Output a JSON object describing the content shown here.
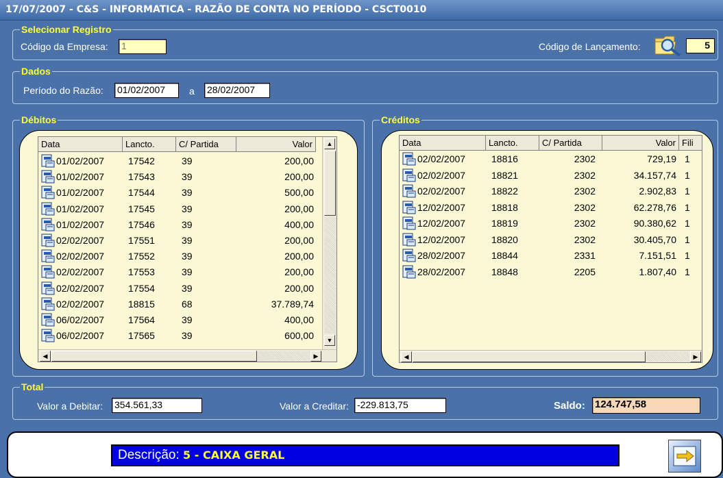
{
  "window": {
    "title": "17/07/2007 - C&S - INFORMATICA - RAZÃO DE CONTA NO PERÍODO - CSCT0010"
  },
  "selecionar": {
    "legend": "Selecionar Registro",
    "empresa_label": "Código da Empresa:",
    "empresa_value": "1",
    "lancamento_label": "Código de Lançamento:",
    "lancamento_value": "5"
  },
  "dados": {
    "legend": "Dados",
    "periodo_label": "Período do Razão:",
    "data_inicio": "01/02/2007",
    "separator": "a",
    "data_fim": "28/02/2007"
  },
  "debitos": {
    "legend": "Débitos",
    "columns": [
      "Data",
      "Lancto.",
      "C/ Partida",
      "Valor"
    ],
    "rows": [
      [
        "01/02/2007",
        "17542",
        "39",
        "200,00"
      ],
      [
        "01/02/2007",
        "17543",
        "39",
        "200,00"
      ],
      [
        "01/02/2007",
        "17544",
        "39",
        "500,00"
      ],
      [
        "01/02/2007",
        "17545",
        "39",
        "200,00"
      ],
      [
        "01/02/2007",
        "17546",
        "39",
        "400,00"
      ],
      [
        "02/02/2007",
        "17551",
        "39",
        "200,00"
      ],
      [
        "02/02/2007",
        "17552",
        "39",
        "200,00"
      ],
      [
        "02/02/2007",
        "17553",
        "39",
        "200,00"
      ],
      [
        "02/02/2007",
        "17554",
        "39",
        "200,00"
      ],
      [
        "02/02/2007",
        "18815",
        "68",
        "37.789,74"
      ],
      [
        "06/02/2007",
        "17564",
        "39",
        "400,00"
      ],
      [
        "06/02/2007",
        "17565",
        "39",
        "600,00"
      ]
    ]
  },
  "creditos": {
    "legend": "Créditos",
    "columns": [
      "Data",
      "Lancto.",
      "C/ Partida",
      "Valor",
      "Fili"
    ],
    "rows": [
      [
        "02/02/2007",
        "18816",
        "2302",
        "729,19",
        "1"
      ],
      [
        "02/02/2007",
        "18821",
        "2302",
        "34.157,74",
        "1"
      ],
      [
        "02/02/2007",
        "18822",
        "2302",
        "2.902,83",
        "1"
      ],
      [
        "12/02/2007",
        "18818",
        "2302",
        "62.278,76",
        "1"
      ],
      [
        "12/02/2007",
        "18819",
        "2302",
        "90.380,62",
        "1"
      ],
      [
        "12/02/2007",
        "18820",
        "2302",
        "30.405,70",
        "1"
      ],
      [
        "28/02/2007",
        "18844",
        "2331",
        "7.151,51",
        "1"
      ],
      [
        "28/02/2007",
        "18848",
        "2205",
        "1.807,40",
        "1"
      ]
    ]
  },
  "total": {
    "legend": "Total",
    "debitar_label": "Valor a Debitar:",
    "debitar_value": "354.561,33",
    "creditar_label": "Valor a Creditar:",
    "creditar_value": "-229.813,75",
    "saldo_label": "Saldo:",
    "saldo_value": "124.747,58"
  },
  "descricao": {
    "label": "Descrição:",
    "value": "5 - CAIXA GERAL"
  },
  "icons": {
    "row": "document-icon",
    "lookup": "folder-search-icon",
    "exit": "exit-icon"
  },
  "colors": {
    "background": "#4a72a8",
    "legend": "#ffff33",
    "list_bg": "#fbf8d6",
    "desc_bar": "#0000e0"
  }
}
